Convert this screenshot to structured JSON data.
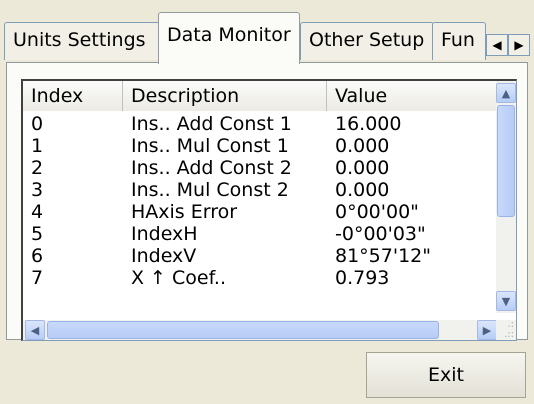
{
  "tabs": [
    {
      "label": "Units Settings",
      "active": false
    },
    {
      "label": "Data Monitor",
      "active": true
    },
    {
      "label": "Other Setup",
      "active": false
    },
    {
      "label": "Fun",
      "active": false
    }
  ],
  "tab_scroll": {
    "left_icon": "arrow-left-icon",
    "right_icon": "arrow-right-icon"
  },
  "list": {
    "columns": {
      "index": "Index",
      "description": "Description",
      "value": "Value"
    },
    "rows": [
      {
        "index": "0",
        "description": "Ins.. Add Const 1",
        "value": "16.000"
      },
      {
        "index": "1",
        "description": "Ins.. Mul Const 1",
        "value": "0.000"
      },
      {
        "index": "2",
        "description": "Ins.. Add Const 2",
        "value": "0.000"
      },
      {
        "index": "3",
        "description": "Ins.. Mul Const 2",
        "value": "0.000"
      },
      {
        "index": "4",
        "description": "HAxis Error",
        "value": "0°00'00\""
      },
      {
        "index": "5",
        "description": "IndexH",
        "value": "-0°00'03\""
      },
      {
        "index": "6",
        "description": "IndexV",
        "value": "81°57'12\""
      },
      {
        "index": "7",
        "description": "X ↑ Coef..",
        "value": "0.793"
      }
    ]
  },
  "footer": {
    "exit_label": "Exit"
  }
}
